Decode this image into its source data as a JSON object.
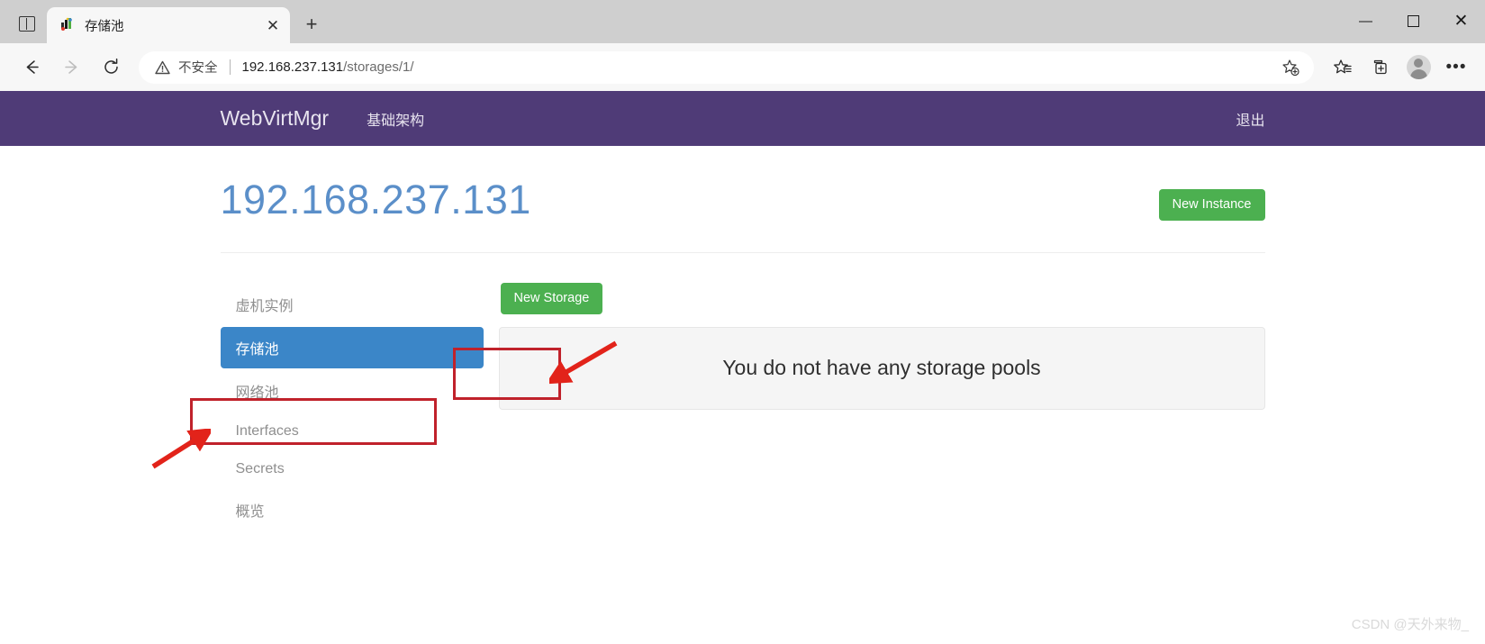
{
  "browser": {
    "tab_list_icon": "tab-list-icon",
    "tab": {
      "title": "存储池",
      "favicon": "webvirtmgr-favicon",
      "close_label": "✕"
    },
    "new_tab_label": "+",
    "window_controls": {
      "minimize": "—",
      "maximize": "maximize-icon",
      "close": "✕"
    },
    "nav": {
      "back": "←",
      "forward": "→",
      "reload": "⟳"
    },
    "address": {
      "security_icon": "warning-triangle-icon",
      "security_label": "不安全",
      "separator": "|",
      "url_host": "192.168.237.131",
      "url_path": "/storages/1/",
      "favorite_icon": "add-favorite-star-icon"
    },
    "toolbar_icons": {
      "favorites": "favorites-star-list-icon",
      "collections": "collections-icon",
      "profile": "profile-avatar-icon",
      "settings": "more-options-icon"
    }
  },
  "app": {
    "navbar": {
      "brand": "WebVirtMgr",
      "link_infrastructure": "基础架构",
      "logout": "退出"
    },
    "page_title": "192.168.237.131",
    "new_instance_label": "New Instance",
    "new_storage_label": "New Storage",
    "sidebar": {
      "items": [
        {
          "label": "虚机实例",
          "active": false
        },
        {
          "label": "存储池",
          "active": true
        },
        {
          "label": "网络池",
          "active": false
        },
        {
          "label": "Interfaces",
          "active": false
        },
        {
          "label": "Secrets",
          "active": false
        },
        {
          "label": "概览",
          "active": false
        }
      ]
    },
    "empty_message": "You do not have any storage pools"
  },
  "watermark": "CSDN @天外来物_",
  "colors": {
    "navbar_purple": "#4f3b77",
    "title_blue": "#5b8fc9",
    "button_green": "#4cb050",
    "active_item_blue": "#3b86c8",
    "annotation_red": "#c0222b"
  }
}
